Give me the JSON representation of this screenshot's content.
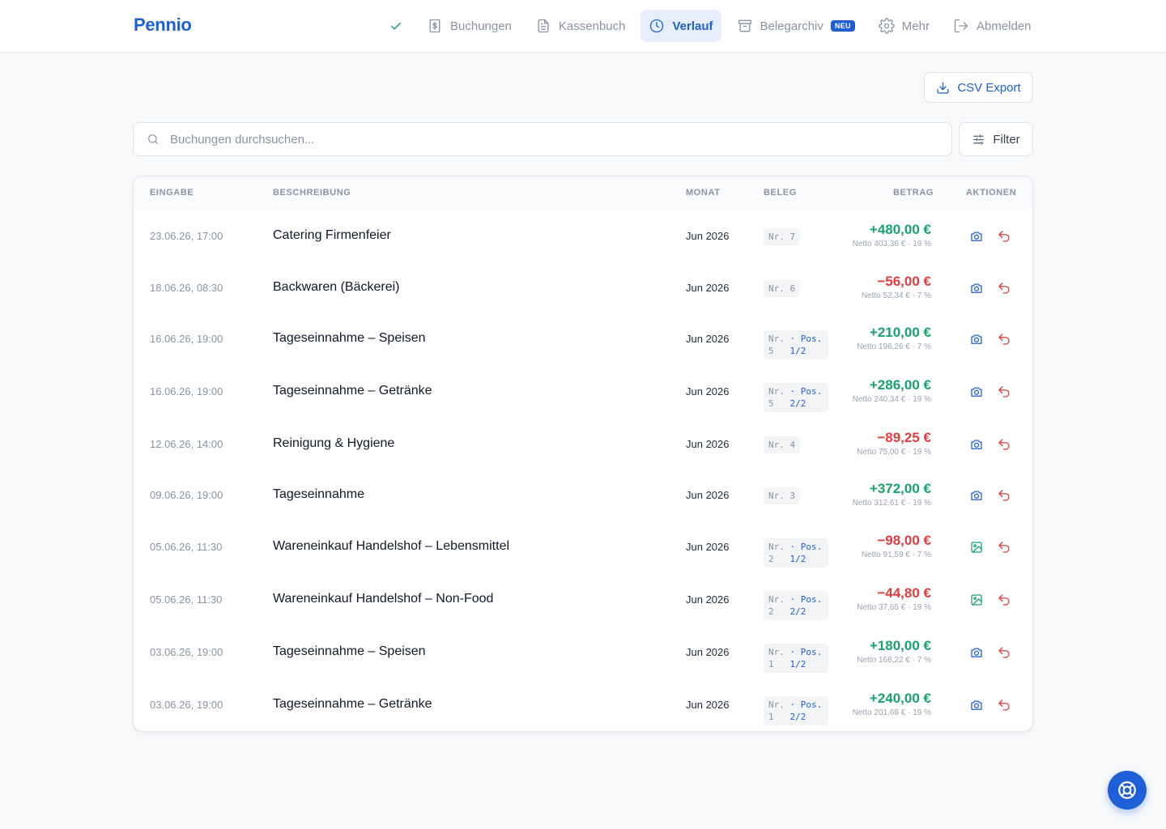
{
  "brand": "Pennio",
  "nav": {
    "items": [
      {
        "label": "Buchungen"
      },
      {
        "label": "Kassenbuch"
      },
      {
        "label": "Verlauf"
      },
      {
        "label": "Belegarchiv",
        "badge": "NEU"
      },
      {
        "label": "Mehr"
      },
      {
        "label": "Abmelden"
      }
    ]
  },
  "toolbar": {
    "csv_label": "CSV Export",
    "search_placeholder": "Buchungen durchsuchen...",
    "filter_label": "Filter"
  },
  "table": {
    "headers": [
      "EINGABE",
      "BESCHREIBUNG",
      "MONAT",
      "BELEG",
      "BETRAG",
      "AKTIONEN"
    ],
    "rows": [
      {
        "date": "23.06.26, 17:00",
        "desc": "Catering Firmenfeier",
        "month": "Jun 2026",
        "beleg": "Nr. 7",
        "amount": "+480,00 €",
        "sign": "pos",
        "net": "Netto 403,36 € · 19 %",
        "receipt": "camera"
      },
      {
        "date": "18.06.26, 08:30",
        "desc": "Backwaren (Bäckerei)",
        "month": "Jun 2026",
        "beleg": "Nr. 6",
        "amount": "−56,00 €",
        "sign": "neg",
        "net": "Netto 52,34 € · 7 %",
        "receipt": "camera"
      },
      {
        "date": "16.06.26, 19:00",
        "desc": "Tageseinnahme – Speisen",
        "month": "Jun 2026",
        "beleg_l1": "Nr.",
        "beleg_l1b": "· Pos.",
        "beleg_l2": "5",
        "beleg_l2b": "1/2",
        "amount": "+210,00 €",
        "sign": "pos",
        "net": "Netto 196,26 € · 7 %",
        "receipt": "camera"
      },
      {
        "date": "16.06.26, 19:00",
        "desc": "Tageseinnahme – Getränke",
        "month": "Jun 2026",
        "beleg_l1": "Nr.",
        "beleg_l1b": "· Pos.",
        "beleg_l2": "5",
        "beleg_l2b": "2/2",
        "amount": "+286,00 €",
        "sign": "pos",
        "net": "Netto 240,34 € · 19 %",
        "receipt": "camera"
      },
      {
        "date": "12.06.26, 14:00",
        "desc": "Reinigung & Hygiene",
        "month": "Jun 2026",
        "beleg": "Nr. 4",
        "amount": "−89,25 €",
        "sign": "neg",
        "net": "Netto 75,00 € · 19 %",
        "receipt": "camera"
      },
      {
        "date": "09.06.26, 19:00",
        "desc": "Tageseinnahme",
        "month": "Jun 2026",
        "beleg": "Nr. 3",
        "amount": "+372,00 €",
        "sign": "pos",
        "net": "Netto 312,61 € · 19 %",
        "receipt": "camera"
      },
      {
        "date": "05.06.26, 11:30",
        "desc": "Wareneinkauf Handelshof – Lebensmittel",
        "month": "Jun 2026",
        "beleg_l1": "Nr.",
        "beleg_l1b": "· Pos.",
        "beleg_l2": "2",
        "beleg_l2b": "1/2",
        "amount": "−98,00 €",
        "sign": "neg",
        "net": "Netto 91,59 € · 7 %",
        "receipt": "image"
      },
      {
        "date": "05.06.26, 11:30",
        "desc": "Wareneinkauf Handelshof – Non-Food",
        "month": "Jun 2026",
        "beleg_l1": "Nr.",
        "beleg_l1b": "· Pos.",
        "beleg_l2": "2",
        "beleg_l2b": "2/2",
        "amount": "−44,80 €",
        "sign": "neg",
        "net": "Netto 37,65 € · 19 %",
        "receipt": "image"
      },
      {
        "date": "03.06.26, 19:00",
        "desc": "Tageseinnahme – Speisen",
        "month": "Jun 2026",
        "beleg_l1": "Nr.",
        "beleg_l1b": "· Pos.",
        "beleg_l2": "1",
        "beleg_l2b": "1/2",
        "amount": "+180,00 €",
        "sign": "pos",
        "net": "Netto 168,22 € · 7 %",
        "receipt": "camera"
      },
      {
        "date": "03.06.26, 19:00",
        "desc": "Tageseinnahme – Getränke",
        "month": "Jun 2026",
        "beleg_l1": "Nr.",
        "beleg_l1b": "· Pos.",
        "beleg_l2": "1",
        "beleg_l2b": "2/2",
        "amount": "+240,00 €",
        "sign": "pos",
        "net": "Netto 201,68 € · 19 %",
        "receipt": "camera"
      }
    ]
  },
  "colors": {
    "accent": "#1d5fd6",
    "positive": "#16a36a",
    "negative": "#e03c3c",
    "muted": "#8a93a3"
  },
  "icons": {
    "nav": [
      "check-icon",
      "invoice-icon",
      "document-icon",
      "clock-icon",
      "archive-icon",
      "gear-icon",
      "logout-icon"
    ],
    "toolbar": [
      "download-icon",
      "search-icon",
      "sliders-icon"
    ],
    "row_actions": [
      "camera-icon",
      "image-icon",
      "undo-icon"
    ],
    "fab": "lifebuoy-icon"
  }
}
